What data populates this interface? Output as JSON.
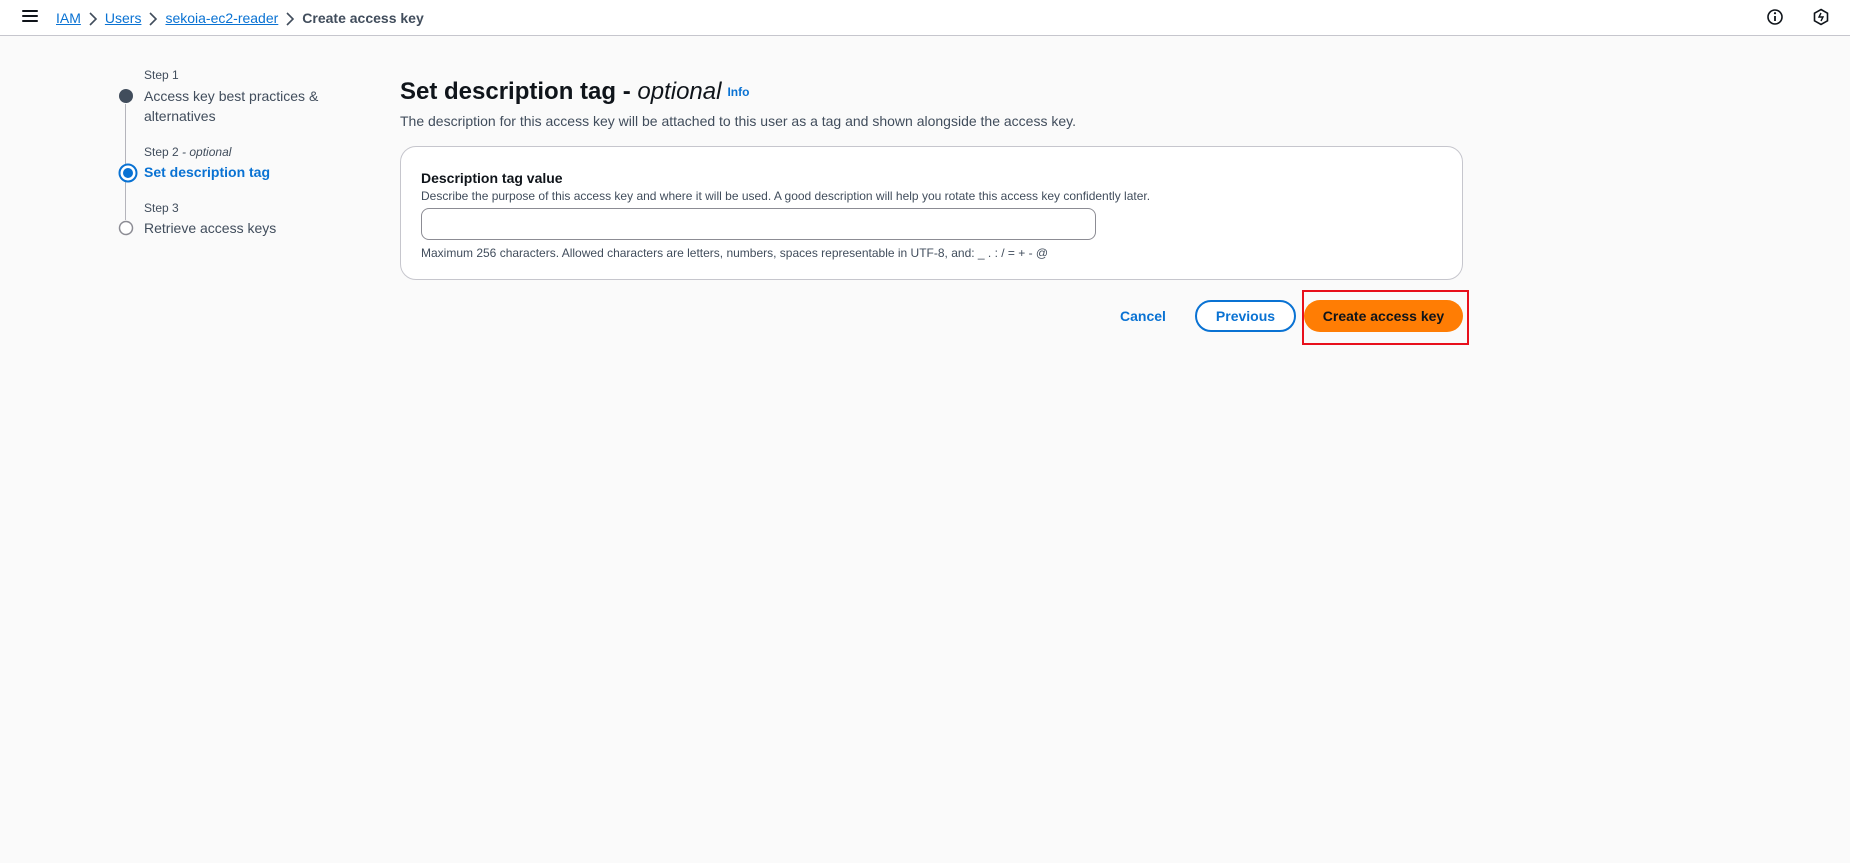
{
  "breadcrumb": {
    "items": [
      "IAM",
      "Users",
      "sekoia-ec2-reader"
    ],
    "current": "Create access key"
  },
  "steps": [
    {
      "number": "Step 1",
      "optional": "",
      "title": "Access key best practices & alternatives",
      "state": "completed"
    },
    {
      "number": "Step 2",
      "optional": "optional",
      "title": "Set description tag",
      "state": "active"
    },
    {
      "number": "Step 3",
      "optional": "",
      "title": "Retrieve access keys",
      "state": "pending"
    }
  ],
  "main": {
    "title": "Set description tag - ",
    "title_optional": "optional",
    "info_link": "Info",
    "description": "The description for this access key will be attached to this user as a tag and shown alongside the access key."
  },
  "form": {
    "label": "Description tag value",
    "description": "Describe the purpose of this access key and where it will be used. A good description will help you rotate this access key confidently later.",
    "value": "",
    "placeholder": "",
    "constraint": "Maximum 256 characters. Allowed characters are letters, numbers, spaces representable in UTF-8, and: _ . : / = + - @"
  },
  "actions": {
    "cancel": "Cancel",
    "previous": "Previous",
    "create": "Create access key"
  },
  "icons": {
    "menu": "hamburger-menu-icon",
    "info": "info-circle-icon",
    "settings": "hexagon-settings-icon",
    "separator": "chevron-right-icon"
  },
  "colors": {
    "link": "#0972d3",
    "primary_button": "#ff7d04",
    "highlight": "#e8101c",
    "background": "#fafafa"
  }
}
